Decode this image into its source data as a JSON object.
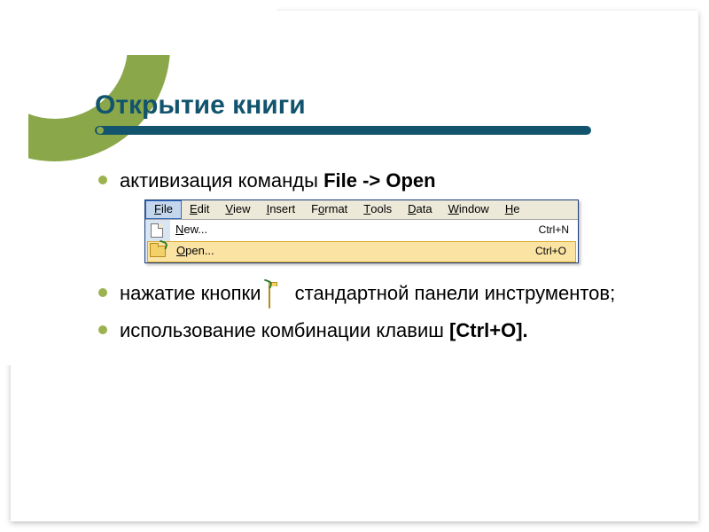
{
  "title": "Открытие книги",
  "bullets": {
    "b1": {
      "pre": "активизация команды ",
      "bold": "File -> Open"
    },
    "b2": {
      "pre": "нажатие кнопки ",
      "post": "стандартной панели инструментов;"
    },
    "b3": {
      "pre": "использование комбинации клавиш ",
      "bold": "[Ctrl+O]."
    }
  },
  "menu": {
    "bar": {
      "file": {
        "u": "F",
        "rest": "ile"
      },
      "edit": {
        "u": "E",
        "rest": "dit"
      },
      "view": {
        "u": "V",
        "rest": "iew"
      },
      "insert": {
        "u": "I",
        "rest": "nsert"
      },
      "format": {
        "u": "",
        "pre": "F",
        "u2": "o",
        "rest": "rmat"
      },
      "tools": {
        "u": "T",
        "rest": "ools"
      },
      "data": {
        "u": "D",
        "rest": "ata"
      },
      "window": {
        "u": "W",
        "rest": "indow"
      },
      "help": {
        "u": "H",
        "rest": "e"
      }
    },
    "items": [
      {
        "label_u": "N",
        "label_rest": "ew...",
        "shortcut": "Ctrl+N",
        "icon": "newdoc"
      },
      {
        "label_u": "O",
        "label_rest": "pen...",
        "shortcut": "Ctrl+O",
        "icon": "folder",
        "highlight": true
      }
    ]
  }
}
